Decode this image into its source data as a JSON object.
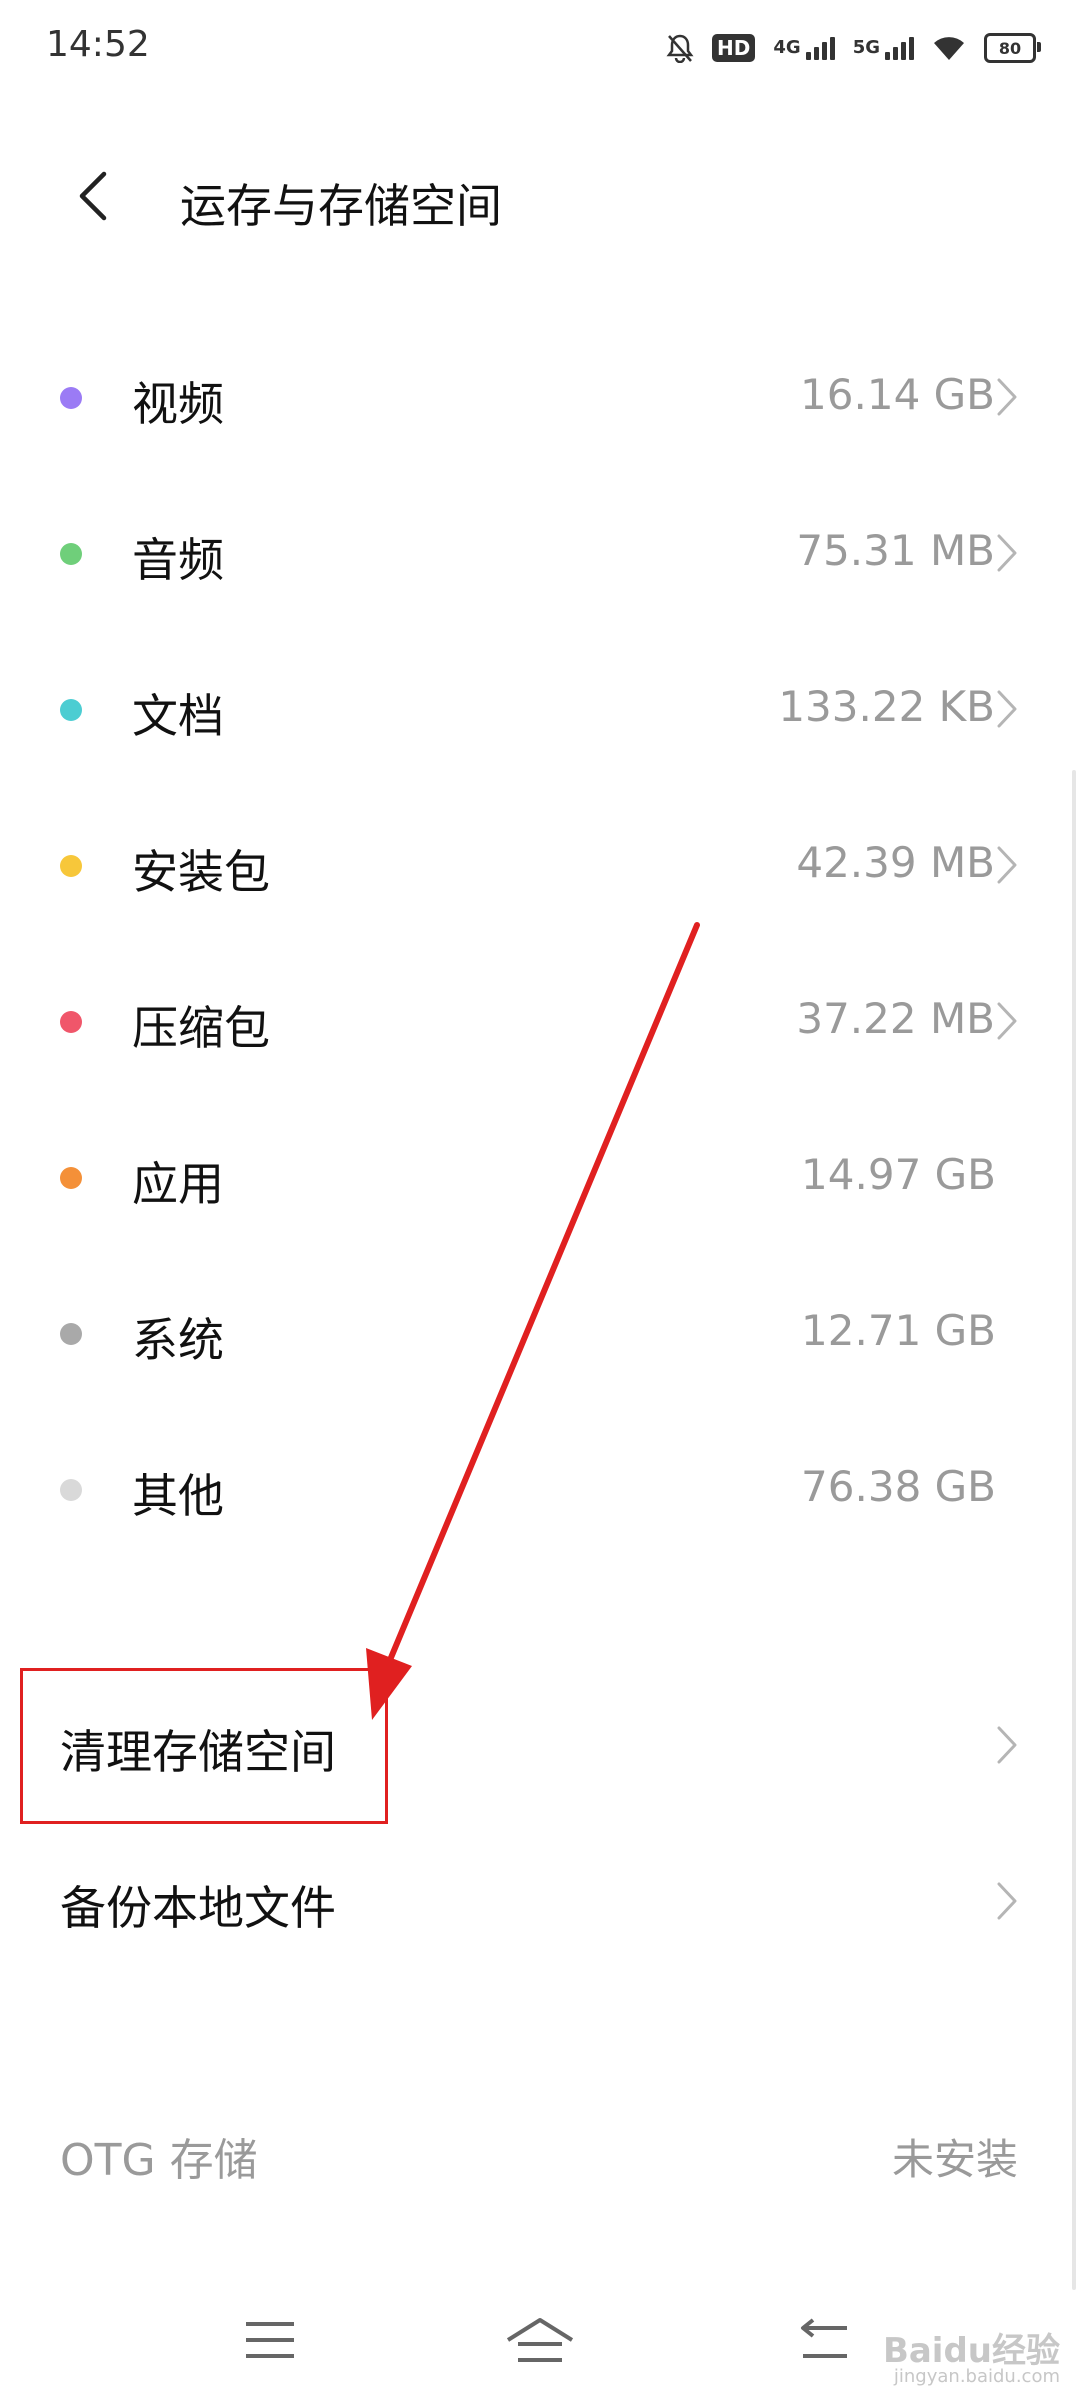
{
  "status_bar": {
    "time": "14:52",
    "hd_label": "HD",
    "network_1": "4G",
    "network_2": "5G",
    "battery": "80"
  },
  "header": {
    "title": "运存与存储空间"
  },
  "categories": [
    {
      "label": "视频",
      "size": "16.14 GB",
      "color": "#9b7bf5",
      "has_arrow": true
    },
    {
      "label": "音频",
      "size": "75.31 MB",
      "color": "#6fcf7a",
      "has_arrow": true
    },
    {
      "label": "文档",
      "size": "133.22 KB",
      "color": "#4ccdd2",
      "has_arrow": true
    },
    {
      "label": "安装包",
      "size": "42.39 MB",
      "color": "#f7c73a",
      "has_arrow": true
    },
    {
      "label": "压缩包",
      "size": "37.22 MB",
      "color": "#f0566a",
      "has_arrow": true
    },
    {
      "label": "应用",
      "size": "14.97 GB",
      "color": "#f49038",
      "has_arrow": false
    },
    {
      "label": "系统",
      "size": "12.71 GB",
      "color": "#a9a9a9",
      "has_arrow": false
    },
    {
      "label": "其他",
      "size": "76.38 GB",
      "color": "#d9d9d9",
      "has_arrow": false
    }
  ],
  "actions": {
    "clean_storage": "清理存储空间",
    "backup_local": "备份本地文件"
  },
  "otg": {
    "label": "OTG 存储",
    "status": "未安装"
  },
  "watermark": {
    "brand": "Baidu经验",
    "url": "jingyan.baidu.com"
  },
  "colors": {
    "annotation_red": "#e02020",
    "muted_text": "#9a9a9a"
  }
}
